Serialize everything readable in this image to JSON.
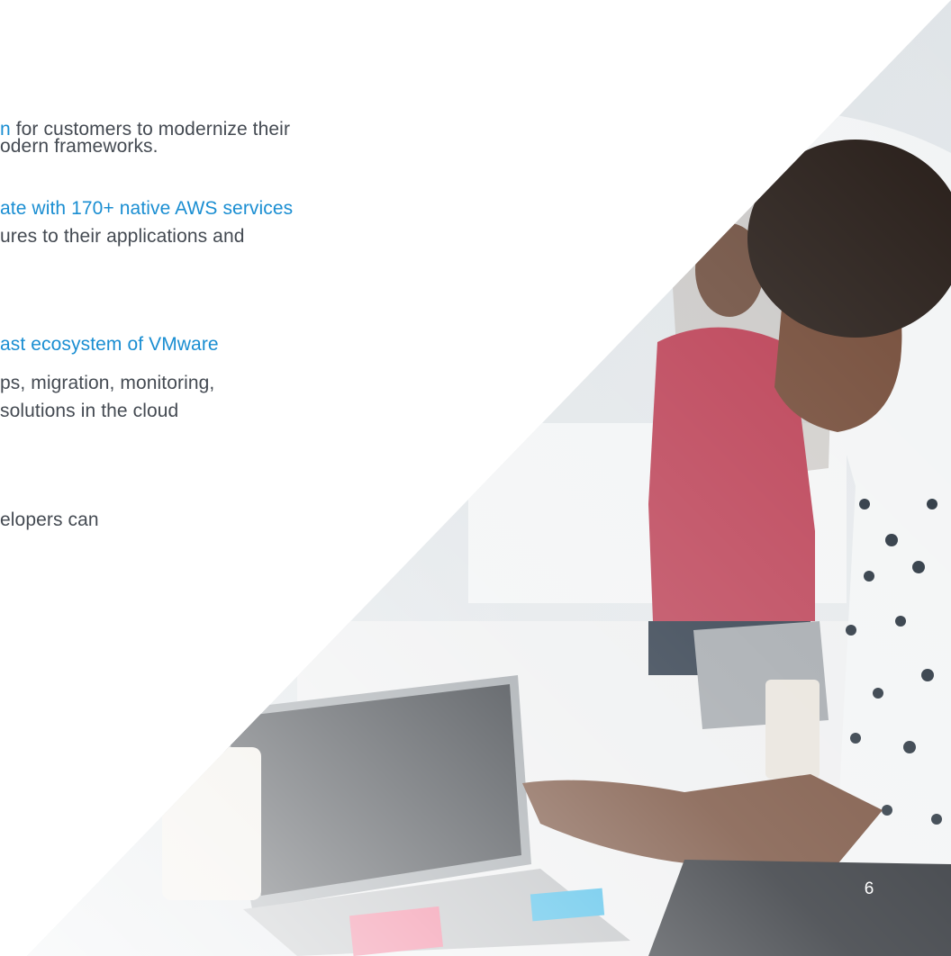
{
  "content": {
    "lines": [
      {
        "parts": [
          {
            "text": "n",
            "link": true
          },
          {
            "text": " for customers to modernize their",
            "link": false
          }
        ]
      },
      {
        "parts": [
          {
            "text": "odern frameworks.",
            "link": false
          }
        ]
      },
      {
        "parts": [
          {
            "text": "ate with 170+ native AWS services",
            "link": true
          }
        ]
      },
      {
        "parts": [
          {
            "text": "ures to their applications and",
            "link": false
          }
        ]
      },
      {
        "parts": [
          {
            "text": "ast ecosystem of VMware",
            "link": true
          }
        ]
      },
      {
        "parts": [
          {
            "text": "ps, migration, monitoring,",
            "link": false
          }
        ]
      },
      {
        "parts": [
          {
            "text": " solutions in the cloud",
            "link": false
          }
        ]
      },
      {
        "parts": [
          {
            "text": "elopers can",
            "link": false
          }
        ]
      }
    ]
  },
  "photo": {
    "alt": "Developers collaborating at a whiteboard with laptops on a table"
  },
  "page_number": "6",
  "colors": {
    "link": "#1a8ed2",
    "body_text": "#444a52"
  }
}
